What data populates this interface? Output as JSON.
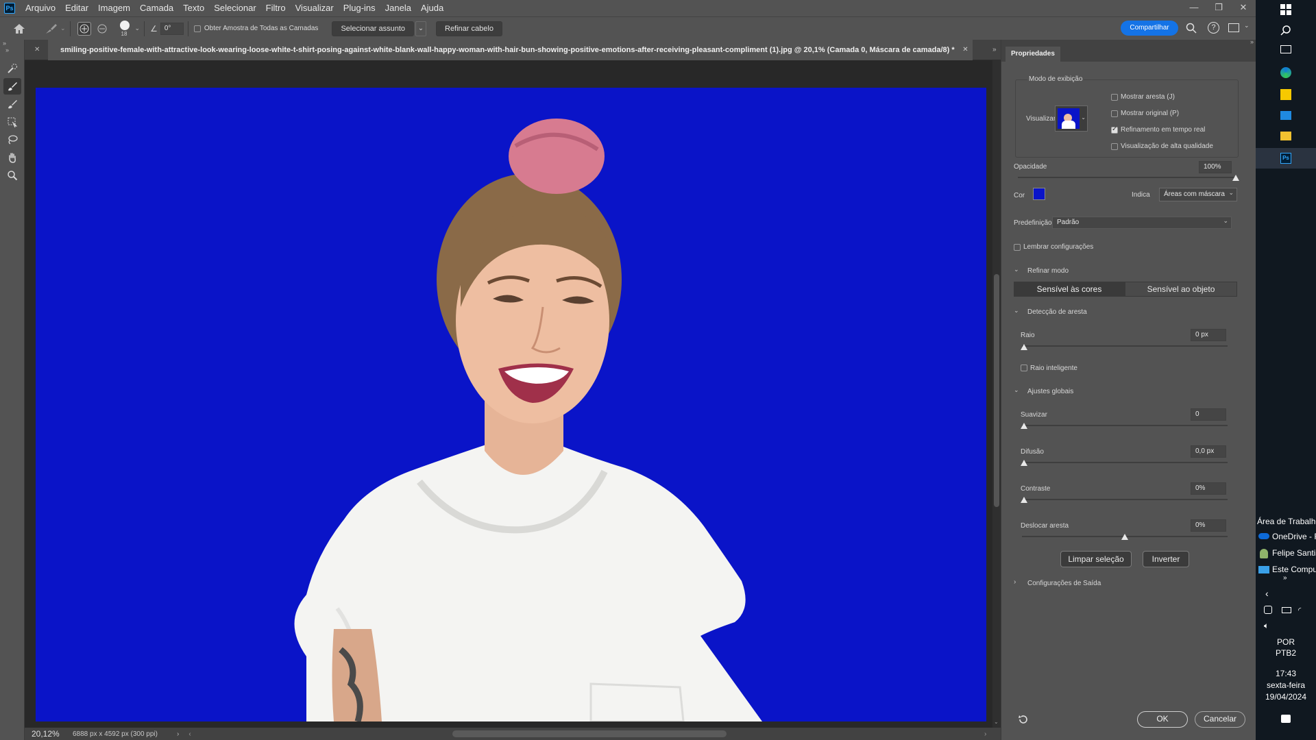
{
  "menubar": {
    "logo": "Ps",
    "items": [
      "Arquivo",
      "Editar",
      "Imagem",
      "Camada",
      "Texto",
      "Selecionar",
      "Filtro",
      "Visualizar",
      "Plug-ins",
      "Janela",
      "Ajuda"
    ]
  },
  "optionsbar": {
    "brush_size": "18",
    "angle": "0°",
    "sample_all_layers": "Obter Amostra de Todas as Camadas",
    "select_subject": "Selecionar assunto",
    "refine_hair": "Refinar cabelo",
    "share": "Compartilhar"
  },
  "document": {
    "tab_title": "smiling-positive-female-with-attractive-look-wearing-loose-white-t-shirt-posing-against-white-blank-wall-happy-woman-with-hair-bun-showing-positive-emotions-after-receiving-pleasant-compliment (1).jpg @ 20,1% (Camada 0, Máscara de camada/8) *",
    "canvas_color": "#0a14c8"
  },
  "status": {
    "zoom": "20,12%",
    "dimensions": "6888 px x 4592 px (300 ppi)"
  },
  "properties": {
    "panel_title": "Propriedades",
    "view_mode_title": "Modo de exibição",
    "view_label": "Visualizar",
    "show_edge": "Mostrar aresta (J)",
    "show_original": "Mostrar original (P)",
    "realtime_refine": "Refinamento em tempo real",
    "high_quality": "Visualização de alta qualidade",
    "opacity_label": "Opacidade",
    "opacity_value": "100%",
    "opacity_fraction": 1.0,
    "color_label": "Cor",
    "color_value": "#0a14c8",
    "indicates_label": "Indica",
    "indicates_value": "Áreas com máscara",
    "preset_label": "Predefinição",
    "preset_value": "Padrão",
    "remember": "Lembrar configurações",
    "refine_mode_title": "Refinar modo",
    "mode_color": "Sensível às cores",
    "mode_object": "Sensível ao objeto",
    "edge_detection_title": "Detecção de aresta",
    "radius_label": "Raio",
    "radius_value": "0 px",
    "smart_radius": "Raio inteligente",
    "global_title": "Ajustes globais",
    "smooth_label": "Suavizar",
    "smooth_value": "0",
    "feather_label": "Difusão",
    "feather_value": "0,0 px",
    "contrast_label": "Contraste",
    "contrast_value": "0%",
    "shift_label": "Deslocar aresta",
    "shift_value": "0%",
    "clear_selection": "Limpar seleção",
    "invert": "Inverter",
    "output_title": "Configurações de Saída",
    "ok": "OK",
    "cancel": "Cancelar"
  },
  "taskbar": {
    "desktop_label": "Área de Trabalho",
    "onedrive": "OneDrive - F",
    "user": "Felipe Santia",
    "computer": "Este Compu",
    "lang1": "POR",
    "lang2": "PTB2",
    "time": "17:43",
    "day": "sexta-feira",
    "date": "19/04/2024"
  }
}
